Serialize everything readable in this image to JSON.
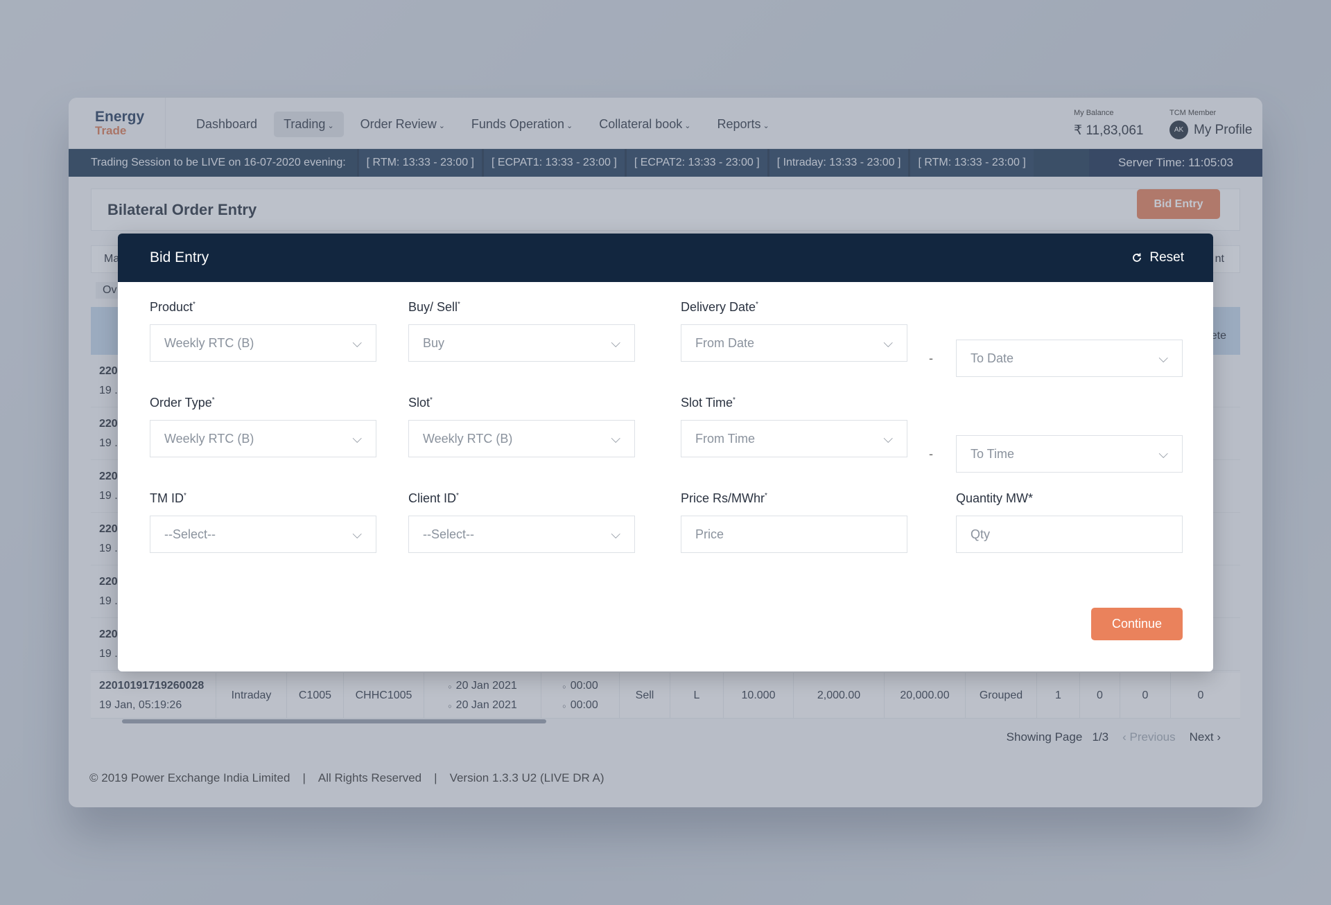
{
  "brand": {
    "line1": "Energy",
    "line2": "Trade"
  },
  "nav": {
    "items": [
      {
        "label": "Dashboard",
        "dropdown": false
      },
      {
        "label": "Trading",
        "dropdown": true,
        "active": true
      },
      {
        "label": "Order Review",
        "dropdown": true
      },
      {
        "label": "Funds Operation",
        "dropdown": true
      },
      {
        "label": "Collateral book",
        "dropdown": true
      },
      {
        "label": "Reports",
        "dropdown": true
      }
    ]
  },
  "balance": {
    "label": "My Balance",
    "value": "₹ 11,83,061"
  },
  "profile": {
    "label": "TCM Member",
    "initials": "AK",
    "name": "My Profile"
  },
  "ticker": {
    "lead": "Trading Session to be LIVE on 16-07-2020 evening:",
    "sessions": [
      "[ RTM:  13:33 - 23:00 ]",
      "[ ECPAT1:  13:33 - 23:00 ]",
      "[ ECPAT2:  13:33 - 23:00 ]",
      "[ Intraday:  13:33 - 23:00 ]",
      "[ RTM:  13:33 - 23:00 ]"
    ],
    "server_time": "Server Time: 11:05:03"
  },
  "page": {
    "title": "Bilateral Order Entry",
    "bid_entry_button": "Bid Entry",
    "tab_partial": "Ma",
    "tab_right_partial": "nt",
    "filter_partial": "Ov",
    "header_right_partial": "lete"
  },
  "hidden_rows": [
    {
      "id": "220",
      "time": "19 ."
    },
    {
      "id": "220",
      "time": "19 ."
    },
    {
      "id": "220",
      "time": "19 ."
    },
    {
      "id": "220",
      "time": "19 ."
    },
    {
      "id": "220",
      "time": "19 ."
    },
    {
      "id": "220",
      "time": "19 ."
    }
  ],
  "last_row": {
    "id": "22010191719260028",
    "time": "19 Jan, 05:19:26",
    "type": "Intraday",
    "client": "C1005",
    "member": "CHHC1005",
    "date_from": "20 Jan 2021",
    "date_to": "20 Jan 2021",
    "time_from": "00:00",
    "time_to": "00:00",
    "side": "Sell",
    "flag": "L",
    "qty": "10.000",
    "price": "2,000.00",
    "value": "20,000.00",
    "status": "Grouped",
    "c1": "1",
    "c2": "0",
    "c3": "0",
    "c4": "0"
  },
  "pager": {
    "label": "Showing Page",
    "page": "1/3",
    "prev": "Previous",
    "next": "Next"
  },
  "footer": {
    "copyright": "© 2019 Power Exchange India Limited",
    "sep": "|",
    "rights": "All Rights Reserved",
    "version": "Version 1.3.3 U2 (LIVE DR A)"
  },
  "modal": {
    "title": "Bid Entry",
    "reset": "Reset",
    "continue": "Continue",
    "fields": {
      "product": {
        "label": "Product",
        "value": "Weekly RTC (B)"
      },
      "buy_sell": {
        "label": "Buy/ Sell",
        "value": "Buy"
      },
      "delivery_date": {
        "label": "Delivery Date",
        "from": "From Date",
        "to": "To Date"
      },
      "order_type": {
        "label": "Order Type",
        "value": "Weekly RTC (B)"
      },
      "slot": {
        "label": "Slot",
        "value": "Weekly RTC (B)"
      },
      "slot_time": {
        "label": "Slot Time",
        "from": "From Time",
        "to": "To Time"
      },
      "tm_id": {
        "label": "TM ID",
        "value": "--Select--"
      },
      "client_id": {
        "label": "Client ID",
        "value": "--Select--"
      },
      "price": {
        "label": "Price Rs/MWhr",
        "placeholder": "Price"
      },
      "quantity": {
        "label": "Quantity MW*",
        "placeholder": "Qty"
      }
    },
    "required_mark": "*",
    "range_sep": "-"
  },
  "colors": {
    "accent": "#e07a55",
    "navy": "#12263f"
  }
}
